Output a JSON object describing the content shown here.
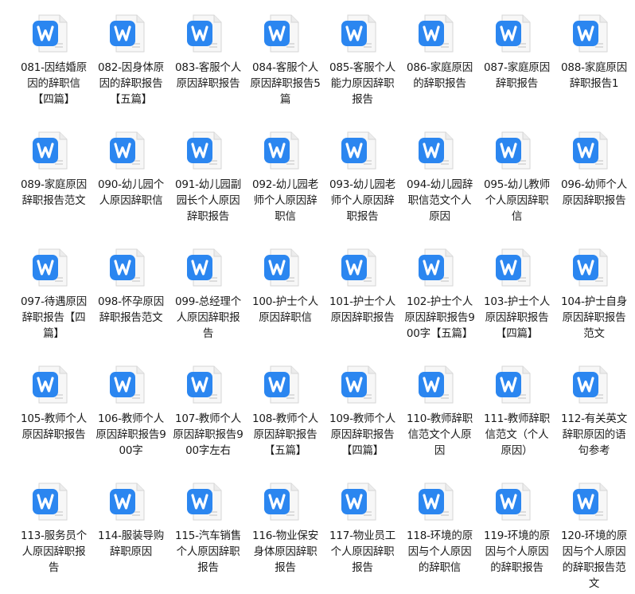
{
  "colors": {
    "background": "#ffffff",
    "icon_badge": "#2b86f0",
    "icon_page": "#f7f7f7",
    "icon_page_border": "#d6d6d6",
    "label_text": "#1a1a1a"
  },
  "file_icon": "wps-writer-document-icon",
  "files": [
    {
      "name": "081-因结婚原因的辞职信【四篇】"
    },
    {
      "name": "082-因身体原因的辞职报告【五篇】"
    },
    {
      "name": "083-客服个人原因辞职报告"
    },
    {
      "name": "084-客服个人原因辞职报告5篇"
    },
    {
      "name": "085-客服个人能力原因辞职报告"
    },
    {
      "name": "086-家庭原因的辞职报告"
    },
    {
      "name": "087-家庭原因辞职报告"
    },
    {
      "name": "088-家庭原因辞职报告1"
    },
    {
      "name": "089-家庭原因辞职报告范文"
    },
    {
      "name": "090-幼儿园个人原因辞职信"
    },
    {
      "name": "091-幼儿园副园长个人原因辞职报告"
    },
    {
      "name": "092-幼儿园老师个人原因辞职信"
    },
    {
      "name": "093-幼儿园老师个人原因辞职报告"
    },
    {
      "name": "094-幼儿园辞职信范文个人原因"
    },
    {
      "name": "095-幼儿教师个人原因辞职信"
    },
    {
      "name": "096-幼师个人原因辞职报告"
    },
    {
      "name": "097-待遇原因辞职报告【四篇】"
    },
    {
      "name": "098-怀孕原因辞职报告范文"
    },
    {
      "name": "099-总经理个人原因辞职报告"
    },
    {
      "name": "100-护士个人原因辞职信"
    },
    {
      "name": "101-护士个人原因辞职报告"
    },
    {
      "name": "102-护士个人原因辞职报告900字【五篇】"
    },
    {
      "name": "103-护士个人原因辞职报告【四篇】"
    },
    {
      "name": "104-护士自身原因辞职报告范文"
    },
    {
      "name": "105-教师个人原因辞职报告"
    },
    {
      "name": "106-教师个人原因辞职报告900字"
    },
    {
      "name": "107-教师个人原因辞职报告900字左右"
    },
    {
      "name": "108-教师个人原因辞职报告【五篇】"
    },
    {
      "name": "109-教师个人原因辞职报告【四篇】"
    },
    {
      "name": "110-教师辞职信范文个人原因"
    },
    {
      "name": "111-教师辞职信范文（个人原因）"
    },
    {
      "name": "112-有关英文辞职原因的语句参考"
    },
    {
      "name": "113-服务员个人原因辞职报告"
    },
    {
      "name": "114-服装导购辞职原因"
    },
    {
      "name": "115-汽车销售个人原因辞职报告"
    },
    {
      "name": "116-物业保安身体原因辞职报告"
    },
    {
      "name": "117-物业员工个人原因辞职报告"
    },
    {
      "name": "118-环境的原因与个人原因的辞职信"
    },
    {
      "name": "119-环境的原因与个人原因的辞职报告"
    },
    {
      "name": "120-环境的原因与个人原因的辞职报告范文"
    }
  ]
}
